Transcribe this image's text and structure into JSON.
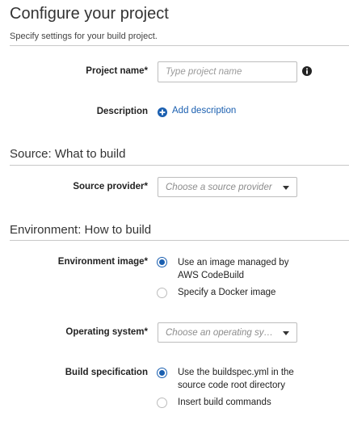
{
  "header": {
    "title": "Configure your project",
    "subtitle": "Specify settings for your build project."
  },
  "project": {
    "name_label": "Project name*",
    "name_placeholder": "Type project name",
    "info_icon": "info-icon",
    "description_label": "Description",
    "add_description_link": "Add description",
    "add_icon": "plus-circle-icon"
  },
  "source": {
    "section_title": "Source: What to build",
    "provider_label": "Source provider*",
    "provider_value": "Choose a source provider"
  },
  "environment": {
    "section_title": "Environment: How to build",
    "image_label": "Environment image*",
    "image_options": [
      {
        "label": "Use an image managed by AWS CodeBuild",
        "selected": true
      },
      {
        "label": "Specify a Docker image",
        "selected": false
      }
    ],
    "os_label": "Operating system*",
    "os_value": "Choose an operating syst…",
    "buildspec_label": "Build specification",
    "buildspec_options": [
      {
        "label": "Use the buildspec.yml in the source code root directory",
        "selected": true
      },
      {
        "label": "Insert build commands",
        "selected": false
      }
    ]
  },
  "colors": {
    "accent": "#1a5fb0",
    "divider": "#c8c8c8"
  }
}
